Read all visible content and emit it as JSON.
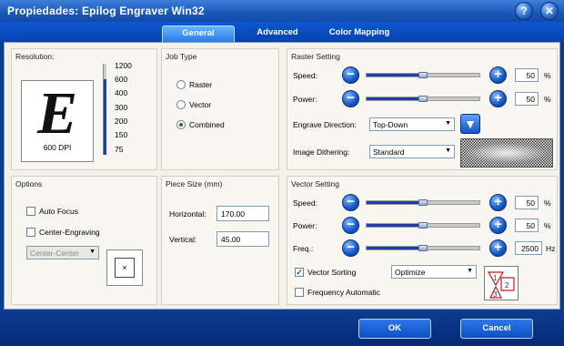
{
  "window": {
    "title": "Propiedades: Epilog Engraver Win32",
    "help_glyph": "?",
    "close_glyph": "✕"
  },
  "tabs": [
    {
      "label": "General",
      "active": true
    },
    {
      "label": "Advanced",
      "active": false
    },
    {
      "label": "Color Mapping",
      "active": false
    }
  ],
  "resolution": {
    "title": "Resolution:",
    "preview_glyph": "E",
    "current": "600 DPI",
    "level": 0.83,
    "values": [
      "1200",
      "600",
      "400",
      "300",
      "200",
      "150",
      "75"
    ]
  },
  "job_type": {
    "title": "Job Type",
    "options": [
      {
        "label": "Raster",
        "selected": false
      },
      {
        "label": "Vector",
        "selected": false
      },
      {
        "label": "Combined",
        "selected": true
      }
    ]
  },
  "raster": {
    "title": "Raster Setting",
    "speed": {
      "label": "Speed:",
      "value": "50",
      "unit": "%",
      "fraction": 0.5
    },
    "power": {
      "label": "Power:",
      "value": "50",
      "unit": "%",
      "fraction": 0.5
    },
    "direction": {
      "label": "Engrave Direction:",
      "value": "Top-Down",
      "button_glyph": "▼"
    },
    "dithering": {
      "label": "Image Dithering:",
      "value": "Standard"
    }
  },
  "options": {
    "title": "Options",
    "auto_focus": {
      "label": "Auto Focus",
      "checked": false
    },
    "center_engraving": {
      "label": "Center-Engraving",
      "checked": false
    },
    "center_mode": "Center-Center",
    "center_glyph": "×"
  },
  "piece_size": {
    "title": "Piece Size (mm)",
    "horizontal": {
      "label": "Horizontal:",
      "value": "170.00"
    },
    "vertical": {
      "label": "Vertical:",
      "value": "45.00"
    }
  },
  "vector": {
    "title": "Vector Setting",
    "speed": {
      "label": "Speed:",
      "value": "50",
      "unit": "%",
      "fraction": 0.5
    },
    "power": {
      "label": "Power:",
      "value": "50",
      "unit": "%",
      "fraction": 0.5
    },
    "freq": {
      "label": "Freq.:",
      "value": "2500",
      "unit": "Hz",
      "fraction": 0.5
    },
    "sorting": {
      "label": "Vector Sorting",
      "checked": true,
      "value": "Optimize"
    },
    "freq_auto": {
      "label": "Frequency Automatic",
      "checked": false
    },
    "sort_image_labels": [
      "1",
      "2",
      "3"
    ]
  },
  "buttons": {
    "minus_glyph": "−",
    "plus_glyph": "+",
    "dropdown_glyph": "▼",
    "check_glyph": "✓"
  },
  "footer": {
    "ok": "OK",
    "cancel": "Cancel"
  },
  "colors": {
    "accent": "#1556c4",
    "titlebar": "#1a56b8",
    "panel": "#f2f1ea",
    "dark_blue": "#0a3c8c"
  }
}
